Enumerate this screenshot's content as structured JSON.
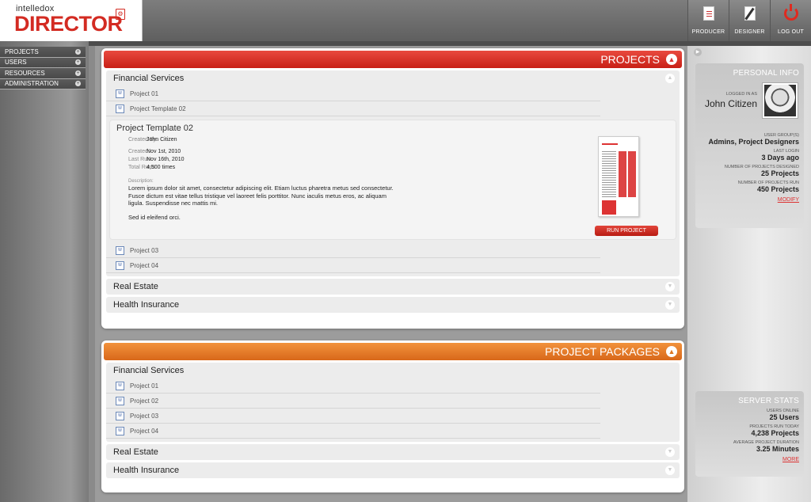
{
  "logo": {
    "small": "intelledox",
    "big": "DIRECTOR"
  },
  "topnav": [
    {
      "label": "PRODUCER",
      "icon": "document-icon"
    },
    {
      "label": "DESIGNER",
      "icon": "pencil-icon"
    },
    {
      "label": "LOG OUT",
      "icon": "power-icon"
    }
  ],
  "sidebar": {
    "items": [
      {
        "label": "PROJECTS"
      },
      {
        "label": "USERS"
      },
      {
        "label": "RESOURCES"
      },
      {
        "label": "ADMINISTRATION"
      }
    ]
  },
  "projects": {
    "title": "PROJECTS",
    "groups": {
      "fin": {
        "title": "Financial Services",
        "rows": [
          "Project 01",
          "Project Template 02",
          "Project 03",
          "Project 04"
        ]
      },
      "re": {
        "title": "Real Estate"
      },
      "hi": {
        "title": "Health Insurance"
      }
    },
    "detail": {
      "title": "Project Template 02",
      "created_by_label": "Created By:",
      "created_by": "John Citizen",
      "created_label": "Created:",
      "created": "Nov 1st, 2010",
      "lastrun_label": "Last Run:",
      "lastrun": "Nov 16th, 2010",
      "totalrun_label": "Total Runs:",
      "totalrun": "4,500 times",
      "desc_label": "Description:",
      "desc": "Lorem ipsum dolor sit amet, consectetur adipiscing elit. Etiam luctus pharetra metus sed consectetur. Fusce dictum est vitae tellus tristique vel laoreet felis porttitor. Nunc iaculis metus eros, ac aliquam ligula. Suspendisse nec mattis mi.",
      "desc2": "Sed id eleifend orci.",
      "run_label": "RUN PROJECT"
    }
  },
  "packages": {
    "title": "PROJECT PACKAGES",
    "groups": {
      "fin": {
        "title": "Financial Services",
        "rows": [
          "Project 01",
          "Project 02",
          "Project 03",
          "Project 04"
        ]
      },
      "re": {
        "title": "Real Estate"
      },
      "hi": {
        "title": "Health Insurance"
      }
    }
  },
  "personal": {
    "title": "PERSONAL INFO",
    "logged_label": "LOGGED IN AS",
    "name": "John Citizen",
    "groups_label": "USER GROUP(S)",
    "groups": "Admins, Project Designers",
    "lastlogin_label": "LAST LOGIN",
    "lastlogin": "3 Days ago",
    "designed_label": "NUMBER OF PROJECTS DESIGNED",
    "designed": "25 Projects",
    "run_label": "NUMBER OF PROJECTS RUN",
    "run": "450 Projects",
    "modify": "MODIFY"
  },
  "server": {
    "title": "SERVER STATS",
    "online_label": "USERS ONLINE",
    "online": "25 Users",
    "today_label": "PROJECTS RUN TODAY",
    "today": "4,238 Projects",
    "avg_label": "AVERAGE PROJECT DURATION",
    "avg": "3.25 Minutes",
    "more": "MORE"
  },
  "colors": {
    "accent_red": "#d32b22",
    "accent_orange": "#e07a2a"
  }
}
